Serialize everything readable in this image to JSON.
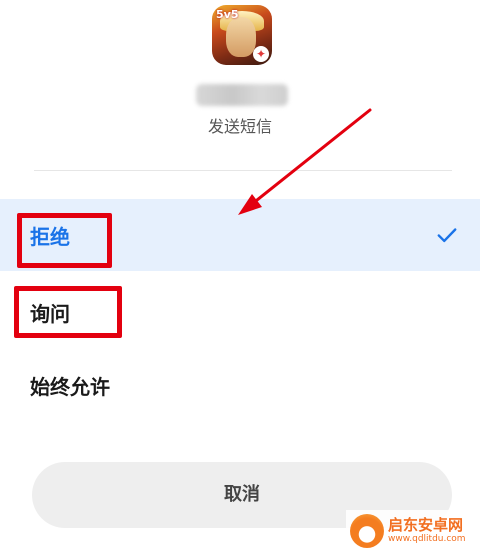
{
  "permission": {
    "name": "发送短信"
  },
  "options": [
    {
      "label": "拒绝",
      "selected": true
    },
    {
      "label": "询问",
      "selected": false
    },
    {
      "label": "始终允许",
      "selected": false
    }
  ],
  "cancel_label": "取消",
  "app_icon_badge": "5v5",
  "watermark": {
    "brand": "启东安卓网",
    "url": "www.qdlitdu.com"
  },
  "colors": {
    "accent": "#1a73e8",
    "selected_bg": "#e6f0fd",
    "annotation": "#e3000f",
    "button_bg": "#eeeeee"
  },
  "icons": {
    "check": "check-icon",
    "arrow": "annotation-arrow"
  }
}
